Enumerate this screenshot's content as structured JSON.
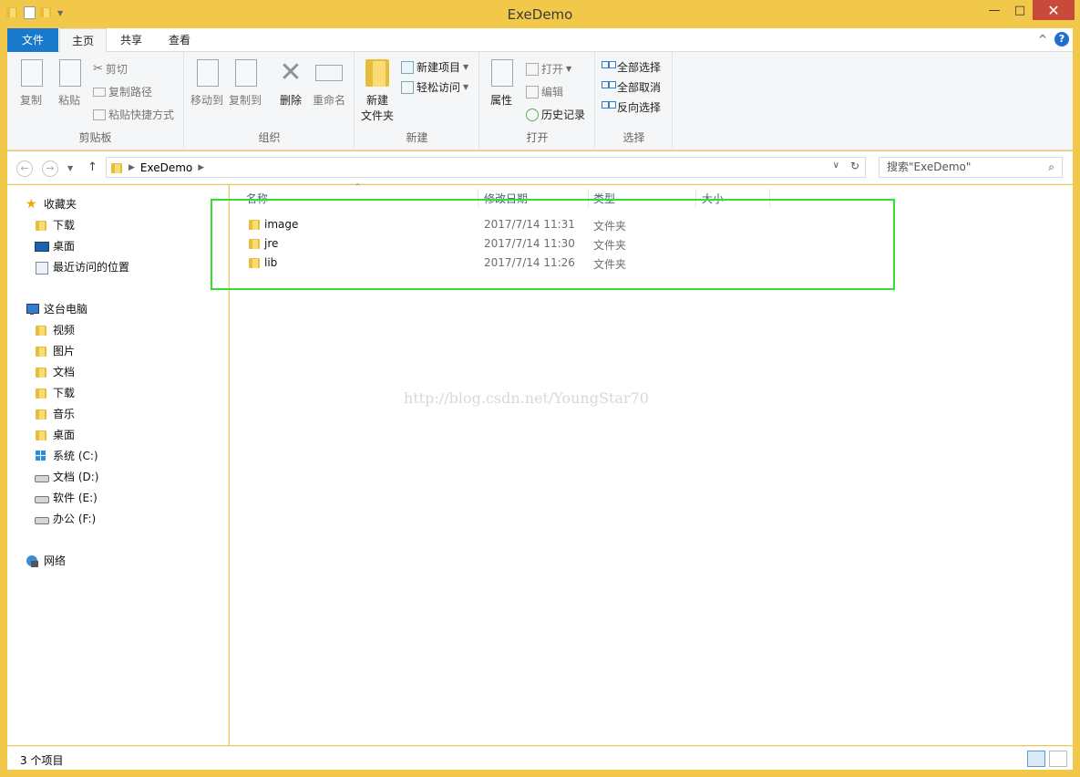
{
  "window": {
    "title": "ExeDemo",
    "controls": {
      "minimize": "—",
      "maximize": "□",
      "close": "✕"
    }
  },
  "ribbon_tabs": {
    "file": "文件",
    "home": "主页",
    "share": "共享",
    "view": "查看",
    "collapse": "^",
    "help": "?"
  },
  "ribbon": {
    "clipboard": {
      "label": "剪贴板",
      "copy": "复制",
      "paste": "粘贴",
      "cut": "剪切",
      "copy_path": "复制路径",
      "paste_shortcut": "粘贴快捷方式"
    },
    "organize": {
      "label": "组织",
      "move_to": "移动到",
      "copy_to": "复制到",
      "delete": "删除",
      "rename": "重命名"
    },
    "new": {
      "label": "新建",
      "new_folder_l1": "新建",
      "new_folder_l2": "文件夹",
      "new_item": "新建项目",
      "easy_access": "轻松访问"
    },
    "open": {
      "label": "打开",
      "properties": "属性",
      "open": "打开",
      "edit": "编辑",
      "history": "历史记录"
    },
    "select": {
      "label": "选择",
      "select_all": "全部选择",
      "select_none": "全部取消",
      "invert": "反向选择"
    }
  },
  "address": {
    "path": [
      "ExeDemo"
    ],
    "search_placeholder": "搜索\"ExeDemo\""
  },
  "nav": {
    "favorites": {
      "label": "收藏夹",
      "items": [
        "下载",
        "桌面",
        "最近访问的位置"
      ]
    },
    "this_pc": {
      "label": "这台电脑",
      "items": [
        "视频",
        "图片",
        "文档",
        "下载",
        "音乐",
        "桌面",
        "系统 (C:)",
        "文档 (D:)",
        "软件 (E:)",
        "办公 (F:)"
      ]
    },
    "network": {
      "label": "网络"
    }
  },
  "columns": {
    "name": "名称",
    "date": "修改日期",
    "type": "类型",
    "size": "大小"
  },
  "files": [
    {
      "name": "image",
      "date": "2017/7/14 11:31",
      "type": "文件夹"
    },
    {
      "name": "jre",
      "date": "2017/7/14 11:30",
      "type": "文件夹"
    },
    {
      "name": "lib",
      "date": "2017/7/14 11:26",
      "type": "文件夹"
    }
  ],
  "watermark": "http://blog.csdn.net/YoungStar70",
  "status": {
    "count": "3 个项目"
  },
  "colors": {
    "file_tab": "#1979ca",
    "highlight": "#33dd33",
    "frame": "#f2c84b",
    "close": "#c74a3b"
  }
}
